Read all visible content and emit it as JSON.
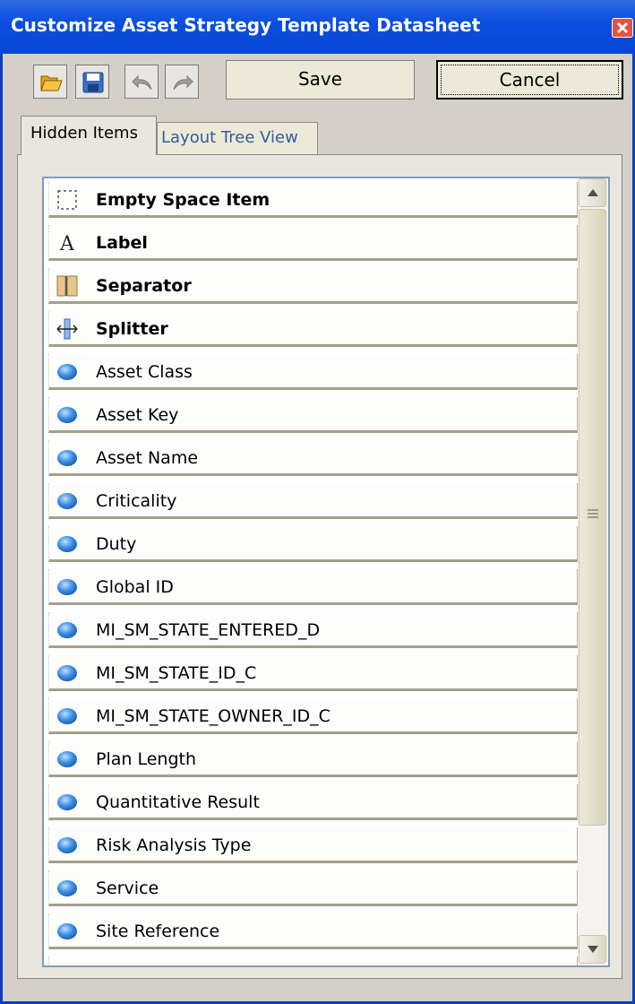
{
  "window": {
    "title": "Customize Asset Strategy Template Datasheet"
  },
  "toolbar": {
    "open_icon": "folder-open-icon",
    "save_icon": "floppy-disk-icon",
    "undo_icon": "undo-icon",
    "redo_icon": "redo-icon",
    "save_label": "Save",
    "cancel_label": "Cancel"
  },
  "tabs": [
    {
      "label": "Hidden Items",
      "active": true
    },
    {
      "label": "Layout Tree View",
      "active": false
    }
  ],
  "list": {
    "items": [
      {
        "label": "Empty Space Item",
        "icon": "empty-space-icon",
        "bold": true
      },
      {
        "label": "Label",
        "icon": "label-icon",
        "bold": true
      },
      {
        "label": "Separator",
        "icon": "separator-icon",
        "bold": true
      },
      {
        "label": "Splitter",
        "icon": "splitter-icon",
        "bold": true
      },
      {
        "label": "Asset Class",
        "icon": "field-bullet-icon",
        "bold": false
      },
      {
        "label": "Asset Key",
        "icon": "field-bullet-icon",
        "bold": false
      },
      {
        "label": "Asset Name",
        "icon": "field-bullet-icon",
        "bold": false
      },
      {
        "label": "Criticality",
        "icon": "field-bullet-icon",
        "bold": false
      },
      {
        "label": "Duty",
        "icon": "field-bullet-icon",
        "bold": false
      },
      {
        "label": "Global ID",
        "icon": "field-bullet-icon",
        "bold": false
      },
      {
        "label": "MI_SM_STATE_ENTERED_D",
        "icon": "field-bullet-icon",
        "bold": false
      },
      {
        "label": "MI_SM_STATE_ID_C",
        "icon": "field-bullet-icon",
        "bold": false
      },
      {
        "label": "MI_SM_STATE_OWNER_ID_C",
        "icon": "field-bullet-icon",
        "bold": false
      },
      {
        "label": "Plan Length",
        "icon": "field-bullet-icon",
        "bold": false
      },
      {
        "label": "Quantitative Result",
        "icon": "field-bullet-icon",
        "bold": false
      },
      {
        "label": "Risk Analysis Type",
        "icon": "field-bullet-icon",
        "bold": false
      },
      {
        "label": "Service",
        "icon": "field-bullet-icon",
        "bold": false
      },
      {
        "label": "Site Reference",
        "icon": "field-bullet-icon",
        "bold": false
      },
      {
        "label": "",
        "icon": "field-bullet-icon",
        "bold": false
      }
    ]
  },
  "colors": {
    "titlebar": "#0a46d4",
    "window_bg": "#d4d0c8",
    "bullet": "#3b8de0"
  }
}
